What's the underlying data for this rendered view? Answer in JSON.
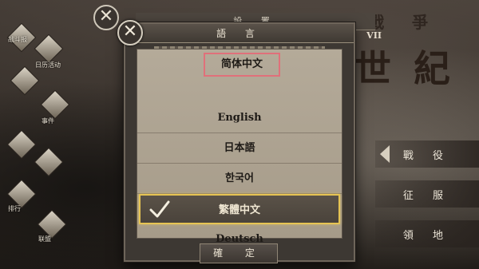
{
  "background": {
    "title_top": "??戰 爭",
    "title_number": "VII",
    "title_main": "世 紀",
    "settings_header": "設 置",
    "side_items": [
      {
        "label": "战斗报",
        "icon": "rose-icon"
      },
      {
        "label": "日历活动",
        "icon": "scroll-icon"
      },
      {
        "label": "",
        "icon": "helmet-icon"
      },
      {
        "label": "事件",
        "icon": "upload-icon"
      },
      {
        "label": "",
        "icon": "mail-icon"
      },
      {
        "label": "",
        "icon": "crest-icon"
      },
      {
        "label": "排行",
        "icon": "crown-icon"
      },
      {
        "label": "联盟",
        "icon": "flag-icon"
      }
    ],
    "right_buttons": [
      "戰 役",
      "征 服",
      "領 地"
    ]
  },
  "dialog": {
    "title": "語 言",
    "close_symbol": "✕",
    "languages": [
      "简体中文",
      "English",
      "日本語",
      "한국어",
      "繁體中文",
      "Deutsch"
    ],
    "selected_index": 4,
    "highlighted_index": 0,
    "confirm_label": "確 定"
  }
}
